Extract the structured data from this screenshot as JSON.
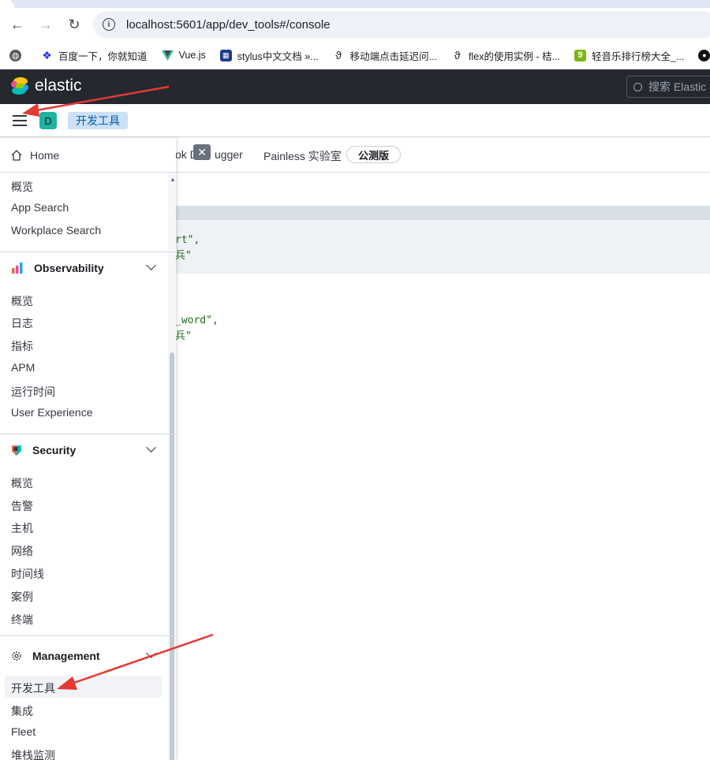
{
  "browser": {
    "url": "localhost:5601/app/dev_tools#/console",
    "bookmarks": [
      {
        "label": "百度一下，你就知道",
        "icon": "paw-icon",
        "color": "#2932e1"
      },
      {
        "label": "Vue.js",
        "icon": "vue-icon",
        "color": "#41b883"
      },
      {
        "label": "stylus中文文档 »...",
        "icon": "stylus-icon",
        "color": "#1e3a8a"
      },
      {
        "label": "移动端点击延迟问...",
        "icon": "feather-icon",
        "color": "#333333"
      },
      {
        "label": "flex的使用实例 - 桔...",
        "icon": "feather-icon",
        "color": "#333333"
      },
      {
        "label": "轻音乐排行榜大全_...",
        "icon": "music-icon",
        "color": "#7cb518"
      },
      {
        "label": "",
        "icon": "github-icon",
        "color": "#111111"
      }
    ]
  },
  "header": {
    "brand": "elastic",
    "search_placeholder": "搜索 Elastic"
  },
  "subheader": {
    "space_initial": "D",
    "breadcrumb": "开发工具"
  },
  "console": {
    "tab_partial": "ok D",
    "tab_partial2": "ugger",
    "painless_tab": "Painless 实验室",
    "beta_badge": "公测版",
    "code_lines": [
      "rt\",",
      "兵\"",
      "_word\",",
      "兵\""
    ]
  },
  "sidenav": {
    "home": "Home",
    "top_items": [
      "概览",
      "App Search",
      "Workplace Search"
    ],
    "observability": {
      "title": "Observability",
      "items": [
        "概览",
        "日志",
        "指标",
        "APM",
        "运行时间",
        "User Experience"
      ]
    },
    "security": {
      "title": "Security",
      "items": [
        "概览",
        "告警",
        "主机",
        "网络",
        "时间线",
        "案例",
        "终端"
      ]
    },
    "management": {
      "title": "Management",
      "items": [
        "开发工具",
        "集成",
        "Fleet",
        "堆栈监测"
      ]
    }
  }
}
